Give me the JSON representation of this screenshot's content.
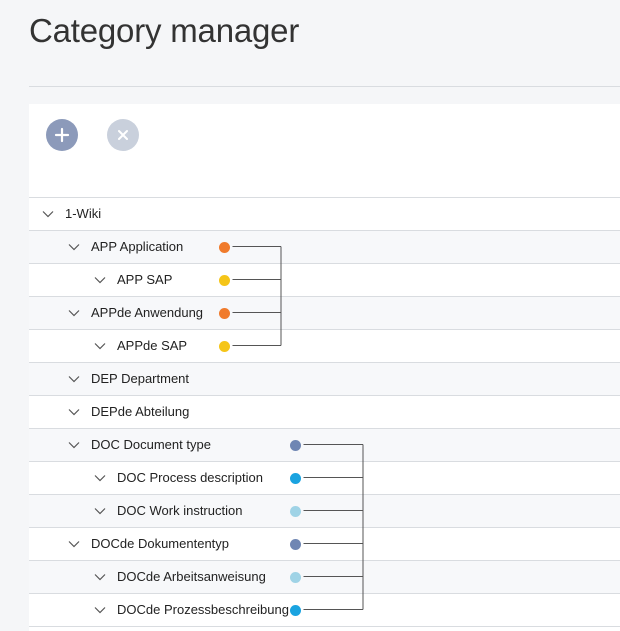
{
  "page": {
    "title": "Category manager"
  },
  "toolbar": {
    "add_icon": "plus-icon",
    "remove_icon": "close-icon",
    "add_color": "#8c9aba",
    "remove_color": "#c9d0dc"
  },
  "colors": {
    "orange": "#f07b2c",
    "yellow": "#f5c518",
    "slate": "#6f86b3",
    "blue": "#1aa3e0",
    "light_blue": "#9fd3e6"
  },
  "tree": [
    {
      "label": "1-Wiki",
      "level": 0
    },
    {
      "label": "APP Application",
      "level": 1,
      "color": "#f07b2c"
    },
    {
      "label": "APP SAP",
      "level": 2,
      "color": "#f5c518"
    },
    {
      "label": "APPde Anwendung",
      "level": 1,
      "color": "#f07b2c"
    },
    {
      "label": "APPde SAP",
      "level": 2,
      "color": "#f5c518"
    },
    {
      "label": "DEP Department",
      "level": 1
    },
    {
      "label": "DEPde Abteilung",
      "level": 1
    },
    {
      "label": "DOC Document type",
      "level": 1,
      "color": "#6f86b3"
    },
    {
      "label": "DOC Process description",
      "level": 2,
      "color": "#1aa3e0"
    },
    {
      "label": "DOC Work instruction",
      "level": 2,
      "color": "#9fd3e6"
    },
    {
      "label": "DOCde Dokumententyp",
      "level": 1,
      "color": "#6f86b3"
    },
    {
      "label": "DOCde Arbeitsanweisung",
      "level": 2,
      "color": "#9fd3e6"
    },
    {
      "label": "DOCde Prozessbeschreibung",
      "level": 2,
      "color": "#1aa3e0"
    }
  ]
}
